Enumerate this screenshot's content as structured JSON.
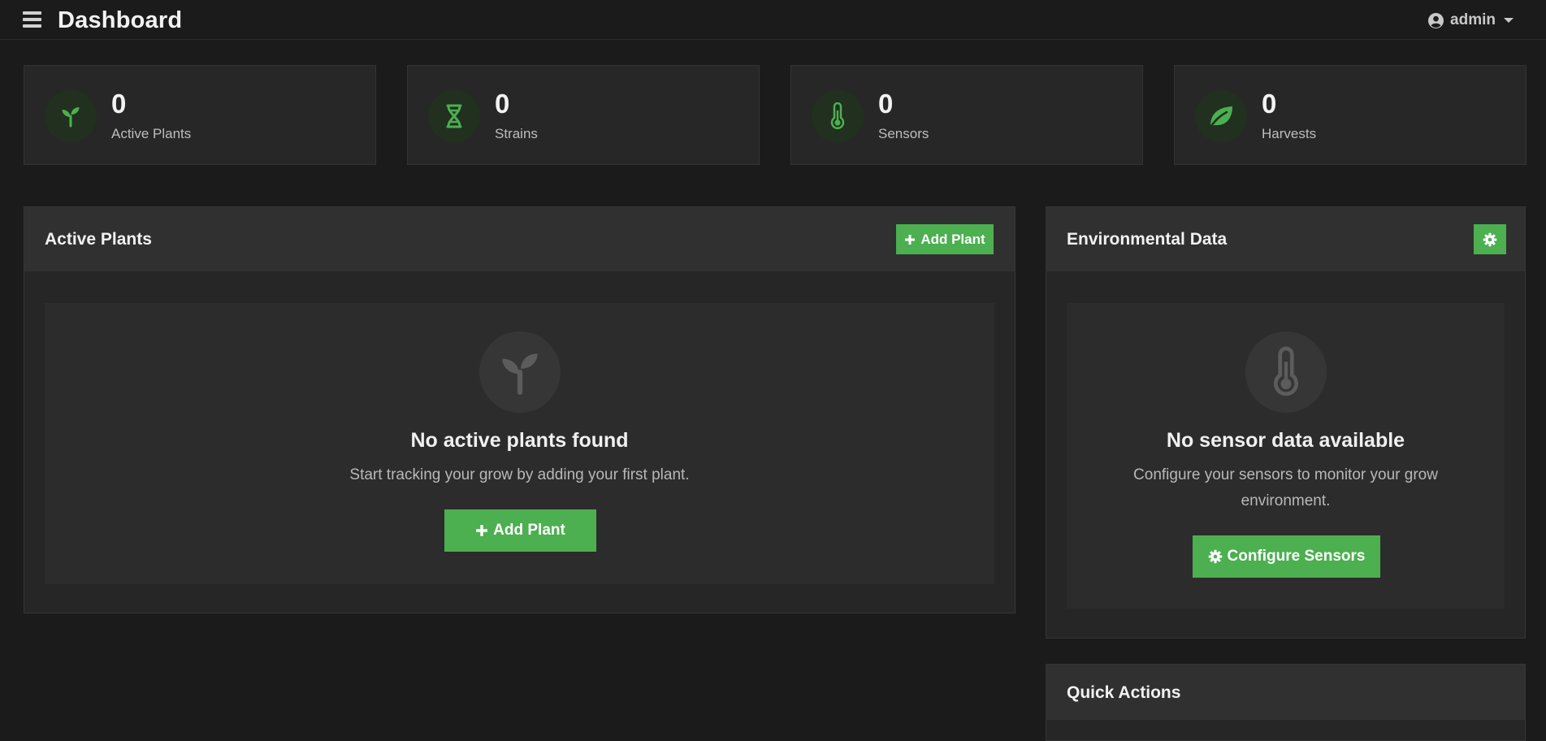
{
  "header": {
    "title": "Dashboard",
    "user": "admin",
    "menu_icon": "hamburger-menu-icon",
    "user_icon": "user-circle-icon"
  },
  "stats": [
    {
      "value": "0",
      "label": "Active Plants",
      "icon": "seedling-icon"
    },
    {
      "value": "0",
      "label": "Strains",
      "icon": "dna-icon"
    },
    {
      "value": "0",
      "label": "Sensors",
      "icon": "thermometer-icon"
    },
    {
      "value": "0",
      "label": "Harvests",
      "icon": "leaf-icon"
    }
  ],
  "active_plants": {
    "title": "Active Plants",
    "add_button": "Add Plant",
    "empty_title": "No active plants found",
    "empty_text": "Start tracking your grow by adding your first plant.",
    "empty_button": "Add Plant"
  },
  "environmental": {
    "title": "Environmental Data",
    "empty_title": "No sensor data available",
    "empty_text_line1": "Configure your sensors to monitor your grow",
    "empty_text_line2": "environment.",
    "configure_button": "Configure Sensors"
  },
  "quick_actions": {
    "title": "Quick Actions"
  },
  "colors": {
    "accent": "#4caf50",
    "background": "#1b1b1b",
    "card": "#272727",
    "panel_header": "#303030"
  }
}
